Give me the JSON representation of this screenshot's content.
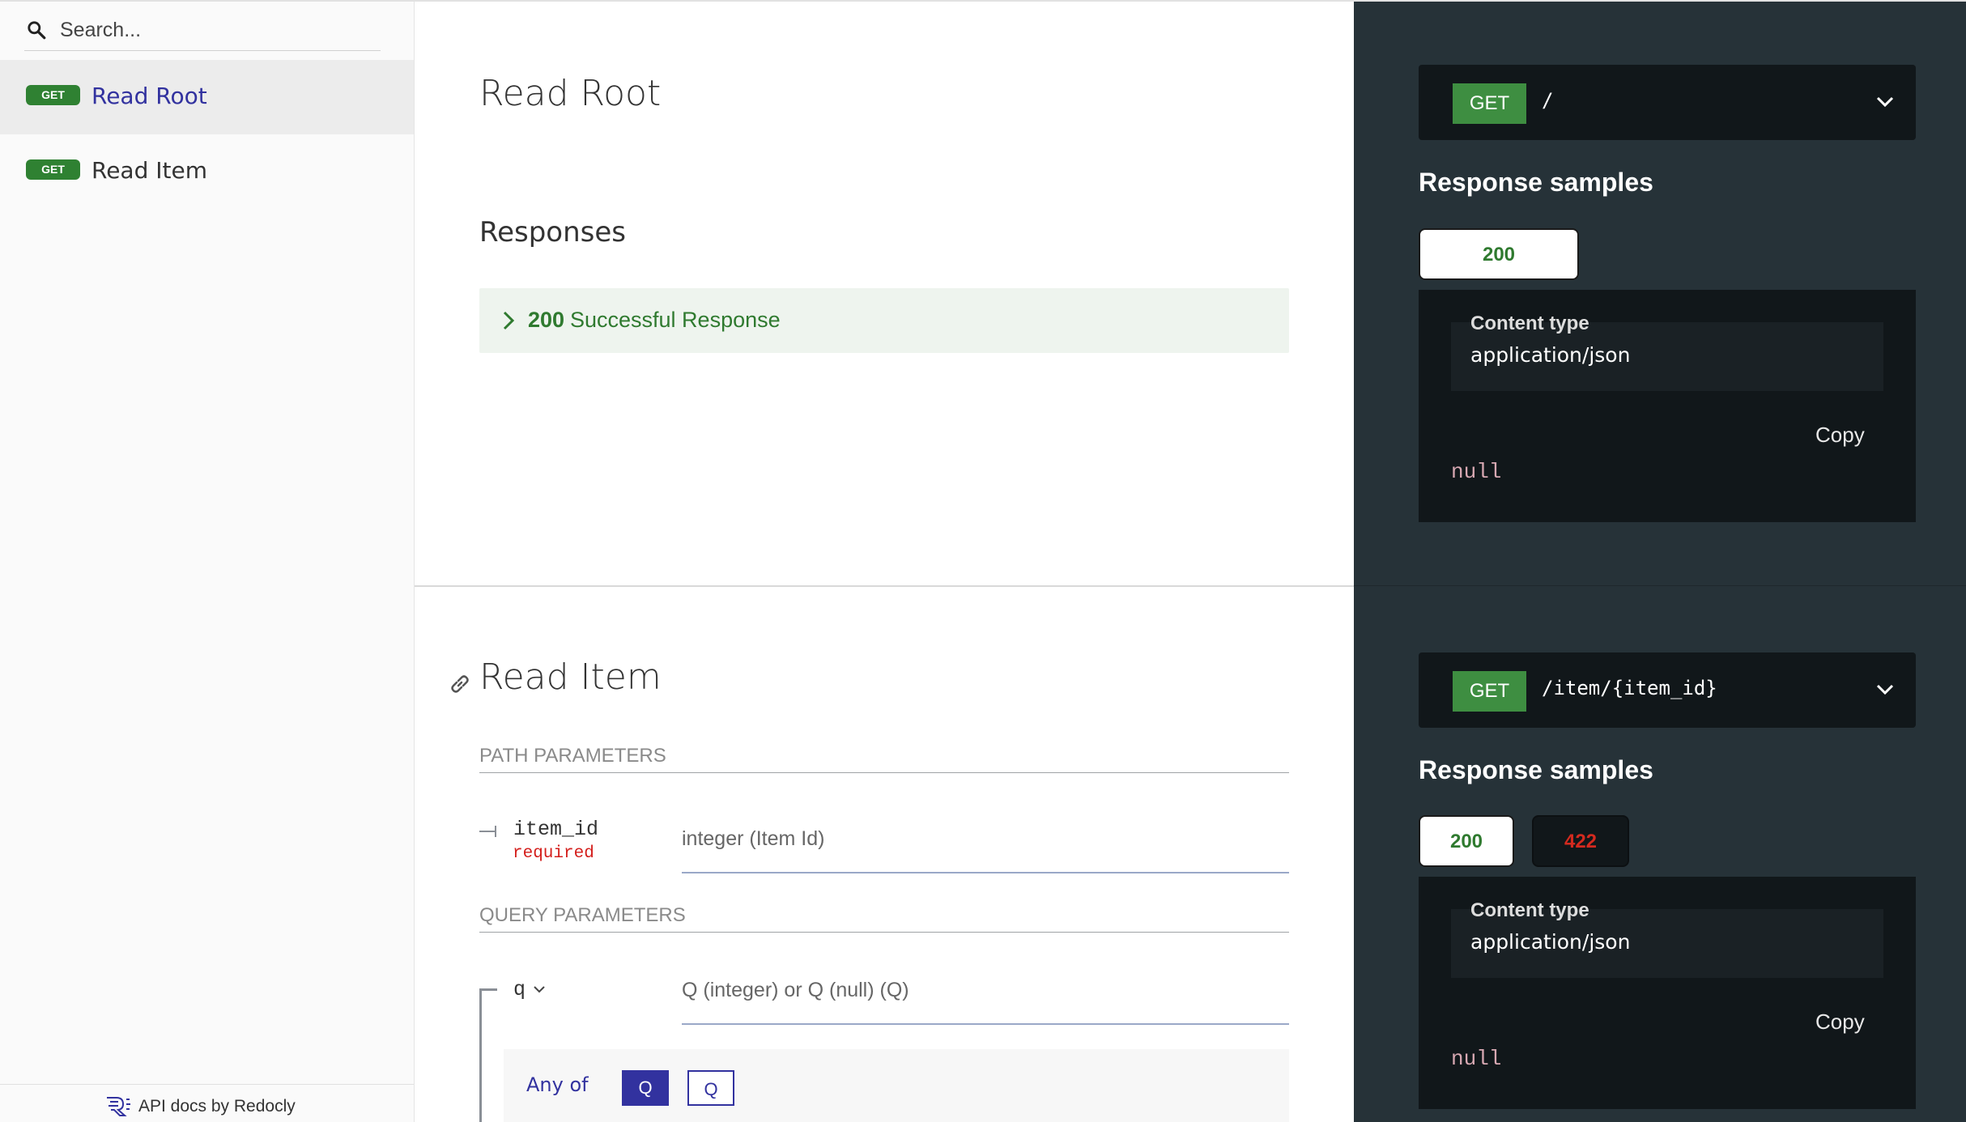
{
  "search": {
    "placeholder": "Search..."
  },
  "sidebar": {
    "items": [
      {
        "method": "GET",
        "label": "Read Root",
        "active": true
      },
      {
        "method": "GET",
        "label": "Read Item",
        "active": false
      }
    ],
    "footer_text": "API docs by Redocly"
  },
  "read_root": {
    "title": "Read Root",
    "responses_heading": "Responses",
    "response": {
      "code": "200",
      "description": "Successful Response"
    }
  },
  "read_item": {
    "title": "Read Item",
    "path_parameters_label": "PATH PARAMETERS",
    "path_param": {
      "name": "item_id",
      "required": "required",
      "type": "integer (Item Id)"
    },
    "query_parameters_label": "QUERY PARAMETERS",
    "query_param": {
      "name": "q",
      "type": "Q (integer) or Q (null) (Q)"
    },
    "any_of": {
      "label": "Any of",
      "options": [
        "Q",
        "Q"
      ],
      "selected_index": 0
    }
  },
  "samples": [
    {
      "method": "GET",
      "path": "/",
      "heading": "Response samples",
      "tabs": [
        "200"
      ],
      "content_type_label": "Content type",
      "content_type": "application/json",
      "copy_label": "Copy",
      "body": "null"
    },
    {
      "method": "GET",
      "path": "/item/{item_id}",
      "heading": "Response samples",
      "tabs": [
        "200",
        "422"
      ],
      "content_type_label": "Content type",
      "content_type": "application/json",
      "copy_label": "Copy",
      "body": "null"
    }
  ],
  "colors": {
    "get_badge": "#2f8132",
    "accent": "#32329f",
    "success": "#2f7a2f",
    "error": "#d42a1f",
    "right_panel": "#263238"
  }
}
